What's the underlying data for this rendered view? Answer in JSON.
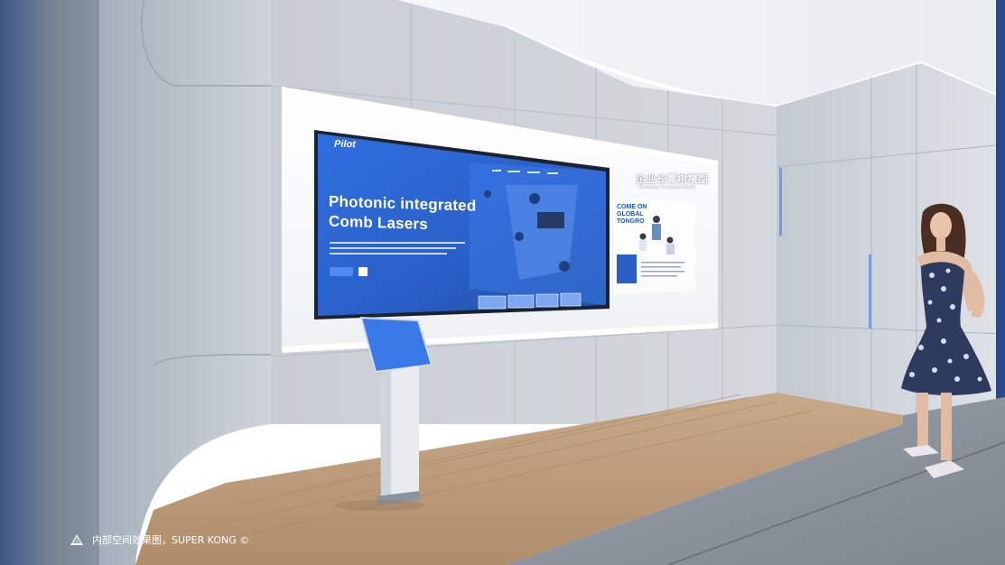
{
  "screen": {
    "brand": "Pilot",
    "headline_line1": "Photonic integrated",
    "headline_line2": "Comb Lasers"
  },
  "wall_panel": {
    "title_cn": "企业长青树模型",
    "title_en": "Enterprise Evergreen Model",
    "come_on": "COME ON GLOBAL TONGRO"
  },
  "caption": {
    "text": "内部空间效果图，SUPER KONG ©"
  }
}
